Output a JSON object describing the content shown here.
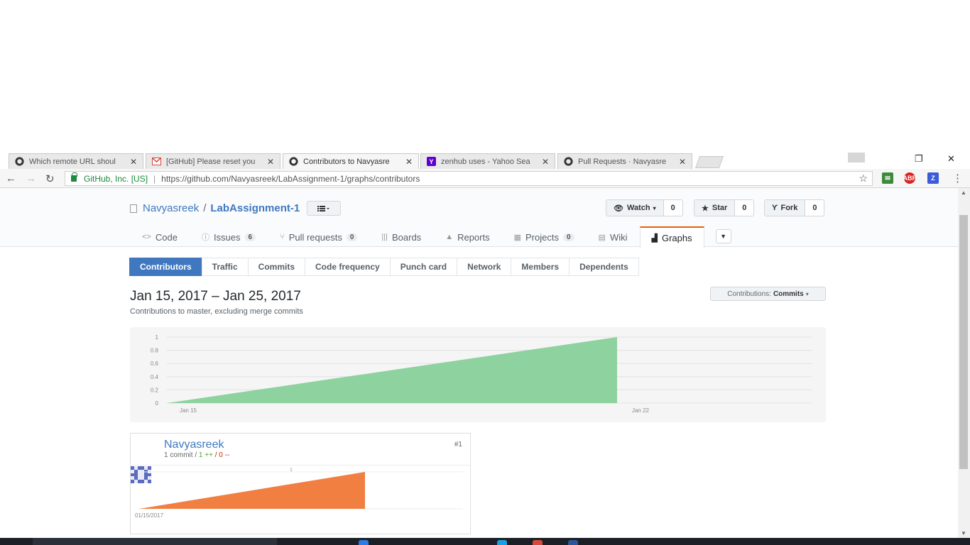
{
  "browser": {
    "tabs": [
      {
        "title": "Which remote URL shoul",
        "favicon": "github-icon"
      },
      {
        "title": "[GitHub] Please reset you",
        "favicon": "gmail-icon"
      },
      {
        "title": "Contributors to Navyasre",
        "favicon": "github-icon",
        "active": true
      },
      {
        "title": "zenhub uses - Yahoo Sea",
        "favicon": "yahoo-icon"
      },
      {
        "title": "Pull Requests · Navyasre",
        "favicon": "github-icon"
      }
    ],
    "close_glyph": "✕",
    "site_identity": "GitHub, Inc. [US]",
    "url": "https://github.com/Navyasreek/LabAssignment-1/graphs/contributors"
  },
  "repo": {
    "owner": "Navyasreek",
    "separator": "/",
    "name": "LabAssignment-1",
    "actions": {
      "watch_label": "Watch",
      "watch_count": "0",
      "star_label": "Star",
      "star_count": "0",
      "fork_label": "Fork",
      "fork_count": "0"
    },
    "nav": {
      "code": "Code",
      "issues": "Issues",
      "issues_count": "6",
      "pulls": "Pull requests",
      "pulls_count": "0",
      "boards": "Boards",
      "reports": "Reports",
      "projects": "Projects",
      "projects_count": "0",
      "wiki": "Wiki",
      "graphs": "Graphs"
    },
    "subnav": {
      "contributors": "Contributors",
      "traffic": "Traffic",
      "commits": "Commits",
      "code_frequency": "Code frequency",
      "punch_card": "Punch card",
      "network": "Network",
      "members": "Members",
      "dependents": "Dependents"
    }
  },
  "graphs_page": {
    "date_range": "Jan 15, 2017 – Jan 25, 2017",
    "subtitle": "Contributions to master, excluding merge commits",
    "contributions_label": "Contributions:",
    "contributions_value": "Commits"
  },
  "chart_data": [
    {
      "type": "area",
      "title": "",
      "x": [
        "Jan 15",
        "Jan 22"
      ],
      "x_ticks": [
        "Jan 15",
        "Jan 22"
      ],
      "y_ticks": [
        "0",
        "0.2",
        "0.4",
        "0.6",
        "0.8",
        "1"
      ],
      "ylim": [
        0,
        1
      ],
      "series": [
        {
          "values": [
            0,
            1
          ]
        }
      ],
      "color": "#8dd29f",
      "grid": true
    },
    {
      "type": "area",
      "title": "",
      "x_ticks": [
        "01/15/2017"
      ],
      "y_ticks": [
        "1"
      ],
      "ylim": [
        0,
        1
      ],
      "series": [
        {
          "values": [
            0,
            1
          ]
        }
      ],
      "color": "#f17f42",
      "grid": true
    }
  ],
  "contributor": {
    "name": "Navyasreek",
    "commits": "1 commit",
    "slash": "/",
    "additions": "1 ++",
    "deletions": "0 --",
    "rank": "#1"
  }
}
